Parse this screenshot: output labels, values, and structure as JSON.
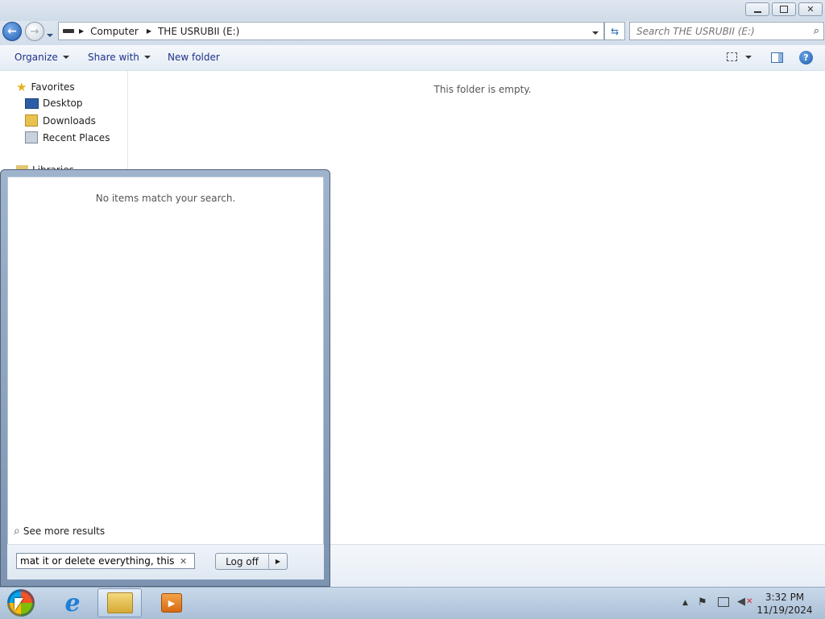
{
  "explorer": {
    "address_path": [
      "Computer",
      "THE USRUBII (E:)"
    ],
    "search_placeholder": "Search THE USRUBII (E:)",
    "toolbar": {
      "organize": "Organize",
      "share_with": "Share with",
      "new_folder": "New folder"
    },
    "nav": {
      "favorites_label": "Favorites",
      "favorites": [
        "Desktop",
        "Downloads",
        "Recent Places"
      ],
      "libraries_label": "Libraries"
    },
    "empty_message": "This folder is empty."
  },
  "start_menu": {
    "no_results": "No items match your search.",
    "see_more": "See more results",
    "search_value": "mat it or delete everything, this is ac",
    "logoff_label": "Log off"
  },
  "taskbar": {
    "time": "3:32 PM",
    "date": "11/19/2024"
  },
  "colors": {
    "accent": "#2e6bb6",
    "taskbar": "#b8cbe0"
  }
}
